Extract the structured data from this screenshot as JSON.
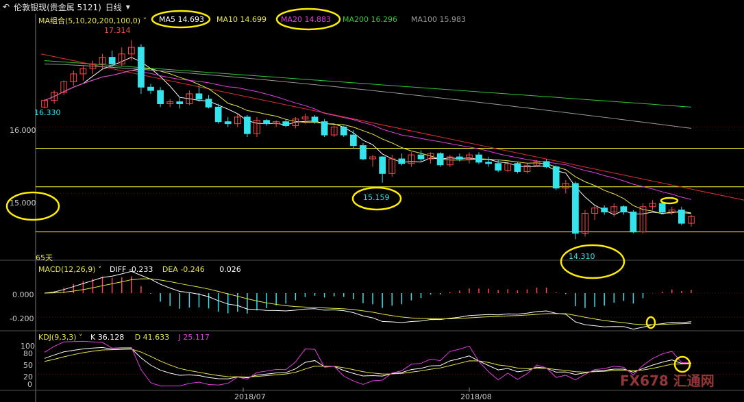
{
  "toolbar": {
    "menu_icon": "back-arrow-icon",
    "instrument": "伦敦银现(贵金属 5121)",
    "period": "日线",
    "period_dropdown_icon": "chevron-down-icon"
  },
  "colors": {
    "background": "#000000",
    "up": "#ff4b4b",
    "down": "#35e3ec",
    "ma5": "#ffffff",
    "ma10": "#e8e84a",
    "ma20": "#e040e0",
    "ma200": "#35c835",
    "ma100": "#9a9a9a",
    "trend": "#e03030",
    "yellow_line": "#ffff30",
    "grid": "#7a1010",
    "circle": "#ffee00"
  },
  "ma_legend": {
    "label": "MA组合(5,10,20,200,100,0)",
    "ma5": "MA5 14.693",
    "ma10": "MA10 14.699",
    "ma20": "MA20 14.883",
    "ma200": "MA200 16.296",
    "ma100": "MA100 15.983"
  },
  "price_panel": {
    "y_ticks": [
      "16.000",
      "15.000"
    ],
    "annotations": {
      "high": "17.314",
      "start": "16.330",
      "low1": "15.159",
      "low2": "14.310"
    },
    "day_count_label": "65天"
  },
  "macd_legend": {
    "label": "MACD(12,26,9)",
    "diff": "DIFF -0.233",
    "dea": "DEA -0.246",
    "macd": "0.026",
    "y_ticks": [
      "0.000",
      "-0.200"
    ]
  },
  "kdj_legend": {
    "label": "KDJ(9,3,3)",
    "k": "K 36.128",
    "d": "D 41.633",
    "j": "J 25.117",
    "y_ticks": [
      "100",
      "80",
      "50",
      "20",
      "0"
    ]
  },
  "x_axis": [
    "2018/07",
    "2018/08"
  ],
  "watermark": "FX678 汇通网",
  "chart_data": {
    "type": "candlestick",
    "title": "伦敦银现(贵金属 5121) 日线",
    "ohlc": [
      [
        16.3,
        16.42,
        16.28,
        16.4
      ],
      [
        16.4,
        16.55,
        16.35,
        16.52
      ],
      [
        16.52,
        16.7,
        16.48,
        16.68
      ],
      [
        16.68,
        16.85,
        16.62,
        16.8
      ],
      [
        16.8,
        16.92,
        16.7,
        16.88
      ],
      [
        16.88,
        17.0,
        16.8,
        16.95
      ],
      [
        16.95,
        17.1,
        16.88,
        17.05
      ],
      [
        17.05,
        17.15,
        16.9,
        16.95
      ],
      [
        16.95,
        17.2,
        16.92,
        17.1
      ],
      [
        17.1,
        17.31,
        17.0,
        17.2
      ],
      [
        17.2,
        17.25,
        16.5,
        16.6
      ],
      [
        16.6,
        16.65,
        16.5,
        16.55
      ],
      [
        16.55,
        16.6,
        16.3,
        16.35
      ],
      [
        16.35,
        16.42,
        16.3,
        16.38
      ],
      [
        16.38,
        16.45,
        16.28,
        16.35
      ],
      [
        16.35,
        16.55,
        16.33,
        16.5
      ],
      [
        16.5,
        16.62,
        16.38,
        16.42
      ],
      [
        16.42,
        16.48,
        16.28,
        16.3
      ],
      [
        16.3,
        16.35,
        16.05,
        16.08
      ],
      [
        16.08,
        16.15,
        16.0,
        16.05
      ],
      [
        16.05,
        16.2,
        16.0,
        16.15
      ],
      [
        16.15,
        16.18,
        15.85,
        15.9
      ],
      [
        15.9,
        16.15,
        15.85,
        16.1
      ],
      [
        16.1,
        16.12,
        16.02,
        16.05
      ],
      [
        16.05,
        16.1,
        16.0,
        16.08
      ],
      [
        16.08,
        16.12,
        16.0,
        16.02
      ],
      [
        16.02,
        16.15,
        15.98,
        16.12
      ],
      [
        16.12,
        16.2,
        16.05,
        16.15
      ],
      [
        16.15,
        16.18,
        16.05,
        16.08
      ],
      [
        16.08,
        16.12,
        15.85,
        15.88
      ],
      [
        15.88,
        16.02,
        15.85,
        16.0
      ],
      [
        16.0,
        16.02,
        15.85,
        15.88
      ],
      [
        15.88,
        15.95,
        15.68,
        15.72
      ],
      [
        15.72,
        15.76,
        15.5,
        15.52
      ],
      [
        15.52,
        15.58,
        15.4,
        15.55
      ],
      [
        15.55,
        15.56,
        15.16,
        15.3
      ],
      [
        15.3,
        15.58,
        15.25,
        15.52
      ],
      [
        15.52,
        15.6,
        15.42,
        15.45
      ],
      [
        15.45,
        15.62,
        15.4,
        15.58
      ],
      [
        15.58,
        15.65,
        15.48,
        15.52
      ],
      [
        15.52,
        15.62,
        15.45,
        15.6
      ],
      [
        15.6,
        15.62,
        15.4,
        15.43
      ],
      [
        15.43,
        15.58,
        15.4,
        15.55
      ],
      [
        15.55,
        15.6,
        15.48,
        15.52
      ],
      [
        15.52,
        15.62,
        15.45,
        15.58
      ],
      [
        15.58,
        15.62,
        15.44,
        15.47
      ],
      [
        15.47,
        15.55,
        15.4,
        15.45
      ],
      [
        15.45,
        15.5,
        15.32,
        15.35
      ],
      [
        15.35,
        15.48,
        15.32,
        15.45
      ],
      [
        15.45,
        15.48,
        15.3,
        15.33
      ],
      [
        15.33,
        15.45,
        15.3,
        15.42
      ],
      [
        15.42,
        15.5,
        15.4,
        15.48
      ],
      [
        15.48,
        15.52,
        15.38,
        15.4
      ],
      [
        15.4,
        15.42,
        15.05,
        15.08
      ],
      [
        15.08,
        15.2,
        15.0,
        15.15
      ],
      [
        15.15,
        15.18,
        14.31,
        14.4
      ],
      [
        14.4,
        14.75,
        14.35,
        14.7
      ],
      [
        14.7,
        14.82,
        14.6,
        14.78
      ],
      [
        14.78,
        14.82,
        14.68,
        14.72
      ],
      [
        14.72,
        14.85,
        14.65,
        14.8
      ],
      [
        14.8,
        14.82,
        14.68,
        14.72
      ],
      [
        14.72,
        14.75,
        14.4,
        14.42
      ],
      [
        14.42,
        14.85,
        14.4,
        14.8
      ],
      [
        14.8,
        14.9,
        14.75,
        14.85
      ],
      [
        14.85,
        14.86,
        14.7,
        14.72
      ],
      [
        14.72,
        14.8,
        14.68,
        14.75
      ],
      [
        14.75,
        14.8,
        14.52,
        14.55
      ],
      [
        14.55,
        14.68,
        14.5,
        14.65
      ]
    ],
    "macd": {
      "diff_last": -0.233,
      "dea_last": -0.246,
      "macd_last": 0.026
    },
    "kdj": {
      "k_last": 36.128,
      "d_last": 41.633,
      "j_last": 25.117
    },
    "x_labels": [
      "2018/07",
      "2018/08"
    ],
    "y_range_price": [
      14.2,
      17.5
    ]
  }
}
